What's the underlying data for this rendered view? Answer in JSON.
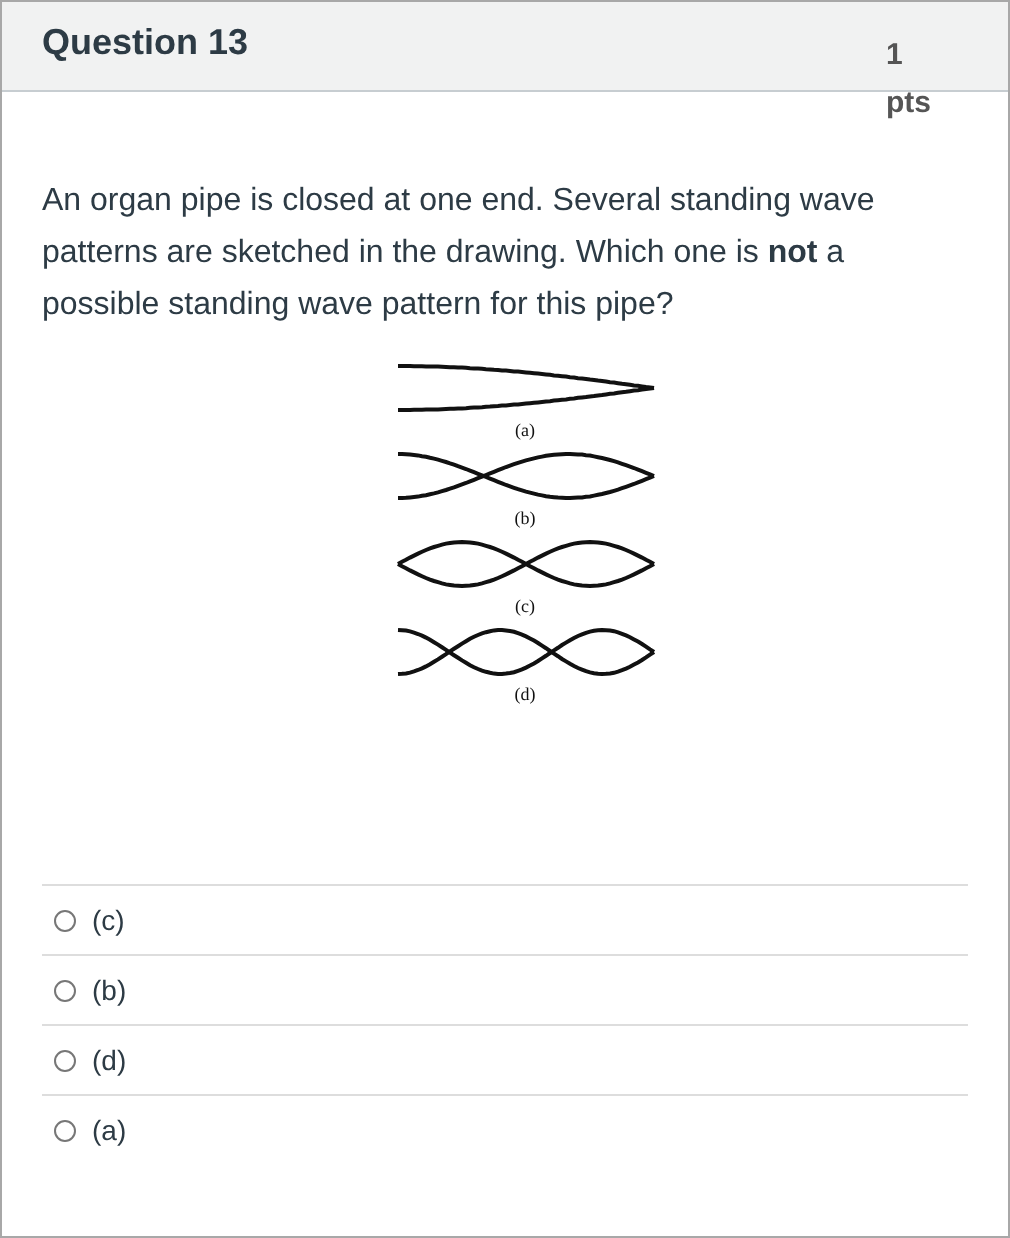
{
  "question": {
    "title": "Question 13",
    "points": "1 pts"
  },
  "prompt": "An organ pipe is closed at one end. Several standing wave patterns are sketched in the drawing. Which one is **not** a possible standing wave pattern for this pipe?",
  "figure": {
    "patterns": [
      {
        "label": "(a)",
        "kind": "quarter"
      },
      {
        "label": "(b)",
        "kind": "three_quarter"
      },
      {
        "label": "(c)",
        "kind": "full"
      },
      {
        "label": "(d)",
        "kind": "five_quarter"
      }
    ]
  },
  "answers": [
    {
      "label": "(c)",
      "selected": false
    },
    {
      "label": "(b)",
      "selected": false
    },
    {
      "label": "(d)",
      "selected": false
    },
    {
      "label": "(a)",
      "selected": false
    }
  ]
}
